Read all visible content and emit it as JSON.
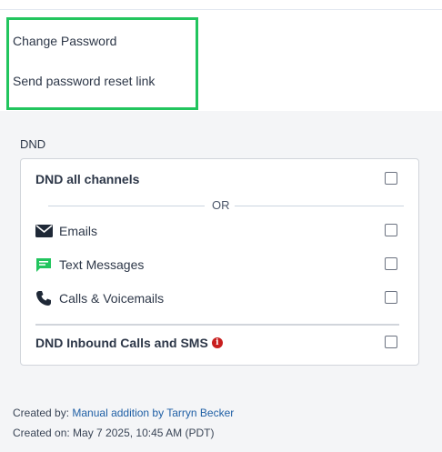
{
  "actions": {
    "change_password": "Change Password",
    "send_reset_link": "Send password reset link"
  },
  "dnd": {
    "section_title": "DND",
    "all_channels_label": "DND all channels",
    "or_label": "OR",
    "channels": [
      {
        "label": "Emails",
        "icon": "envelope-icon"
      },
      {
        "label": "Text Messages",
        "icon": "message-icon"
      },
      {
        "label": "Calls & Voicemails",
        "icon": "phone-icon"
      }
    ],
    "inbound_label": "DND Inbound Calls and SMS",
    "checked": {
      "all_channels": false,
      "emails": false,
      "text_messages": false,
      "calls": false,
      "inbound": false
    }
  },
  "meta": {
    "created_by_label": "Created by: ",
    "created_by_value": "Manual addition by Tarryn Becker",
    "created_on_label": "Created on: ",
    "created_on_value": "May 7 2025, 10:45 AM (PDT)"
  },
  "colors": {
    "highlight": "#22c55e",
    "message_icon": "#22c55e",
    "info_icon": "#c81e1e",
    "link": "#1f5fa5"
  }
}
